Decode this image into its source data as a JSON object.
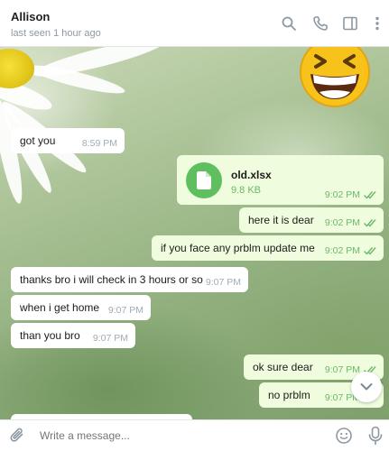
{
  "header": {
    "name": "Allison",
    "status": "last seen 1 hour ago"
  },
  "messages": [
    {
      "dir": "in",
      "text": "got you",
      "time": "8:59 PM"
    },
    {
      "dir": "out",
      "type": "file",
      "file_name": "old.xlsx",
      "file_size": "9.8 KB",
      "time": "9:02 PM",
      "read": true
    },
    {
      "dir": "out",
      "text": "here it is dear",
      "time": "9:02 PM",
      "read": true
    },
    {
      "dir": "out",
      "text": "if you face any prblm update me",
      "time": "9:02 PM",
      "read": true
    },
    {
      "dir": "in",
      "text": "thanks bro i will check in 3 hours or so",
      "time": "9:07 PM"
    },
    {
      "dir": "in",
      "text": "when i get home",
      "time": "9:07 PM"
    },
    {
      "dir": "in",
      "text": "than you bro",
      "time": "9:07 PM"
    },
    {
      "dir": "out",
      "text": "ok sure dear",
      "time": "9:07 PM",
      "read": true
    },
    {
      "dir": "out",
      "text": "no prblm",
      "time": "9:07 PM",
      "read": true
    }
  ],
  "composer": {
    "placeholder": "Write a message..."
  },
  "icons": {
    "header": [
      "search-icon",
      "phone-icon",
      "sidebar-toggle-icon",
      "more-vertical-icon"
    ],
    "composer": [
      "paperclip-icon",
      "emoji-icon",
      "microphone-icon"
    ],
    "scroll": "chevron-down-icon"
  },
  "colors": {
    "outgoing_bubble": "#effdde",
    "incoming_bubble": "#ffffff",
    "accent_green": "#5fbf5f",
    "read_tick": "#6cb869"
  }
}
